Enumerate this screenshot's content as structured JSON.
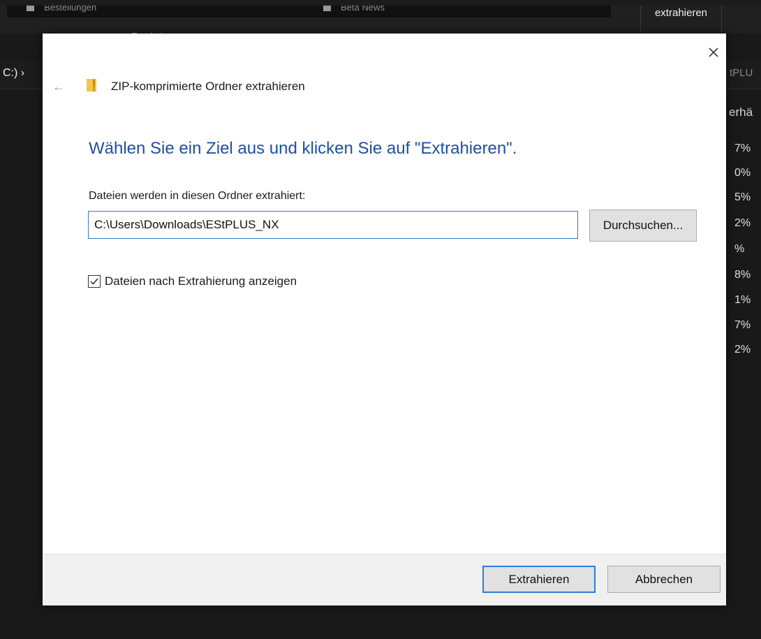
{
  "background": {
    "tabs": [
      "Bestellungen",
      "Beta News"
    ],
    "ribbon_button": "extrahieren",
    "subtitle": "Ergebnisse",
    "address_left": "C:) ›",
    "address_right": "tPLU",
    "column_header": "erhä",
    "percentages": [
      "7%",
      "0%",
      "5%",
      "2%",
      "%",
      "8%",
      "1%",
      "7%",
      "2%"
    ]
  },
  "dialog": {
    "title": "ZIP-komprimierte Ordner extrahieren",
    "instruction": "Wählen Sie ein Ziel aus und klicken Sie auf \"Extrahieren\".",
    "field_label": "Dateien werden in diesen Ordner extrahiert:",
    "path_value": "C:\\Users\\Downloads\\EStPLUS_NX",
    "browse_label": "Durchsuchen...",
    "checkbox_label": "Dateien nach Extrahierung anzeigen",
    "checkbox_checked": true,
    "extract_label": "Extrahieren",
    "cancel_label": "Abbrechen"
  },
  "colors": {
    "instruction_blue": "#1f4fa0",
    "focus_border": "#2f7bd6",
    "zip_folder": "#f4c54a"
  }
}
